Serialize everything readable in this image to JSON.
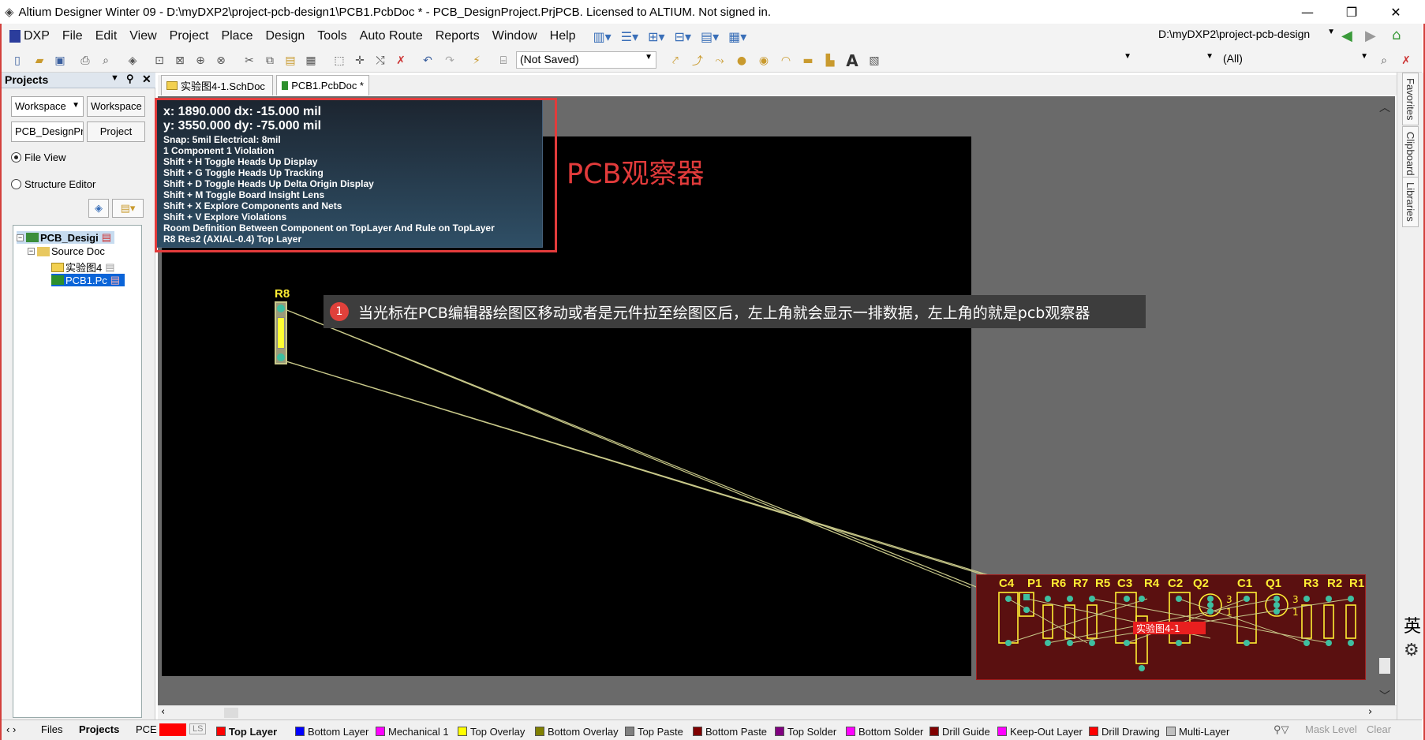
{
  "window": {
    "title": "Altium Designer Winter 09 - D:\\myDXP2\\project-pcb-design1\\PCB1.PcbDoc * - PCB_DesignProject.PrjPCB. Licensed to ALTIUM. Not signed in.",
    "minimize": "—",
    "restore": "❐",
    "close": "✕"
  },
  "menu": {
    "dxp": "DXP",
    "items": [
      "File",
      "Edit",
      "View",
      "Project",
      "Place",
      "Design",
      "Tools",
      "Auto Route",
      "Reports",
      "Window",
      "Help"
    ],
    "path_combo": "D:\\myDXP2\\project-pcb-design"
  },
  "toolbar": {
    "variant_combo": "(Not Saved)",
    "filter_combo": "(All)"
  },
  "projects_panel": {
    "title": "Projects",
    "workspace_combo": "Workspace",
    "workspace_button": "Workspace",
    "project_combo": "PCB_DesignPr",
    "project_button": "Project",
    "file_view": "File View",
    "structure_editor": "Structure Editor",
    "tree": {
      "root": "PCB_Desigi",
      "source": "Source Doc",
      "sch": "实验图4",
      "pcb": "PCB1.Pc"
    }
  },
  "doc_tabs": [
    {
      "label": "实验图4-1.SchDoc"
    },
    {
      "label": "PCB1.PcbDoc *"
    }
  ],
  "hud": {
    "line1": "x:  1890.000   dx:   -15.000  mil",
    "line2": "y:  3550.000   dy:   -75.000  mil",
    "snap": "Snap: 5mil Electrical: 8mil",
    "violation": "1 Component 1 Violation",
    "shortcuts": [
      "Shift + H   Toggle Heads Up Display",
      "Shift + G   Toggle Heads Up Tracking",
      "Shift + D   Toggle Heads Up Delta Origin Display",
      "Shift + M  Toggle Board Insight Lens",
      "Shift + X   Explore Components and Nets",
      "Shift + V   Explore Violations"
    ],
    "room": "Room Definition Between Component on TopLayer And Rule on TopLayer",
    "component": "R8 Res2 (AXIAL-0.4)  Top Layer"
  },
  "annotation": {
    "label": "PCB观察器",
    "callout_number": "1",
    "callout_text": "当光标在PCB编辑器绘图区移动或者是元件拉至绘图区后，左上角就会显示一排数据，左上角的就是pcb观察器"
  },
  "board": {
    "moving_component": "R8",
    "components": [
      "C4",
      "P1",
      "R6",
      "R7",
      "R5",
      "C3",
      "R4",
      "C2",
      "Q2",
      "C1",
      "Q1",
      "R3",
      "R2",
      "R1"
    ],
    "room_label": "实验图4-1",
    "pin_labels": [
      "3",
      "1",
      "3",
      "1"
    ]
  },
  "right_rail": {
    "tabs": [
      "Favorites",
      "Clipboard",
      "Libraries"
    ],
    "ime": "英"
  },
  "bottom_tabs": {
    "files": "Files",
    "projects": "Projects",
    "pcb": "PCE",
    "ls": "LS"
  },
  "layers": [
    {
      "name": "Top Layer",
      "color": "#ff0000"
    },
    {
      "name": "Bottom Layer",
      "color": "#0000ff"
    },
    {
      "name": "Mechanical 1",
      "color": "#ff00ff"
    },
    {
      "name": "Top Overlay",
      "color": "#ffff00"
    },
    {
      "name": "Bottom Overlay",
      "color": "#808000"
    },
    {
      "name": "Top Paste",
      "color": "#808080"
    },
    {
      "name": "Bottom Paste",
      "color": "#800000"
    },
    {
      "name": "Top Solder",
      "color": "#800080"
    },
    {
      "name": "Bottom Solder",
      "color": "#ff00ff"
    },
    {
      "name": "Drill Guide",
      "color": "#800000"
    },
    {
      "name": "Keep-Out Layer",
      "color": "#ff00ff"
    },
    {
      "name": "Drill Drawing",
      "color": "#ff0000"
    },
    {
      "name": "Multi-Layer",
      "color": "#c0c0c0"
    }
  ],
  "status_right": {
    "mask": "Mask Level",
    "clear": "Clear"
  }
}
